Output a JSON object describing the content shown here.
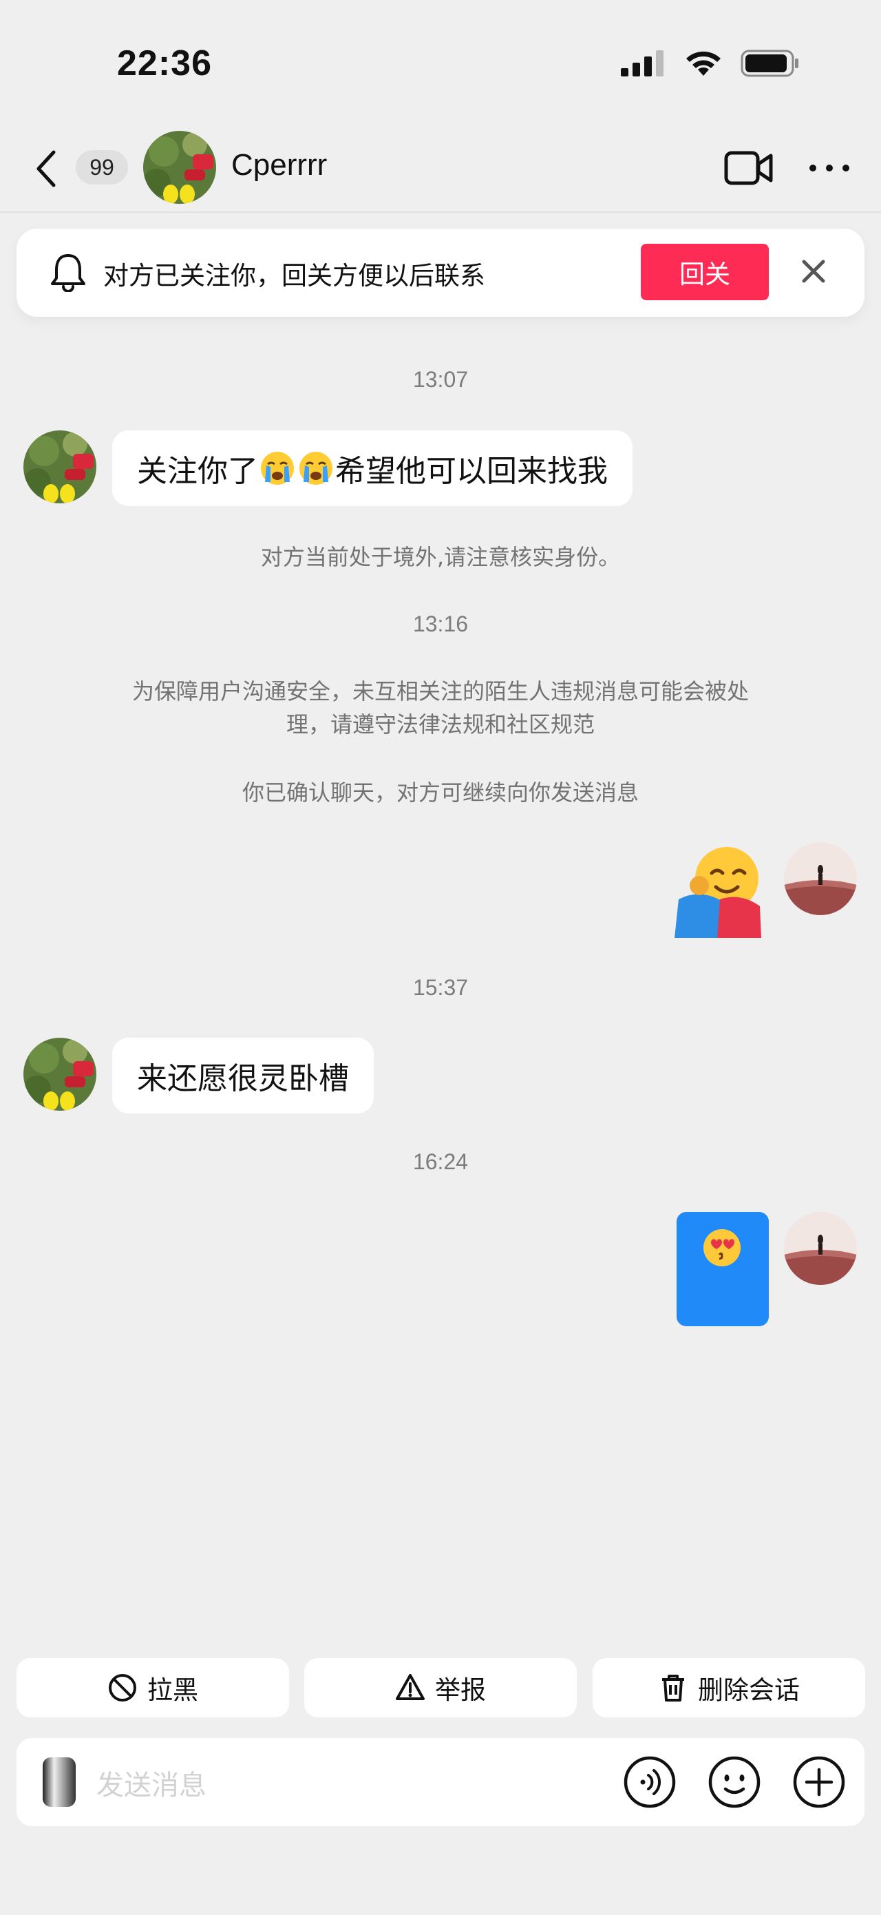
{
  "status_bar": {
    "time": "22:36"
  },
  "header": {
    "unread_count": "99",
    "name": "Cperrrr"
  },
  "banner": {
    "text": "对方已关注你，回关方便以后联系",
    "follow_back": "回关"
  },
  "messages": {
    "t1": "13:07",
    "m1_before": "关注你了",
    "m1_after": "希望他可以回来找我",
    "notice_abroad": "对方当前处于境外,请注意核实身份。",
    "t2": "13:16",
    "notice_safety_line1": "为保障用户沟通安全，未互相关注的陌生人违规消息可能会被处",
    "notice_safety_line2": "理，请遵守法律法规和社区规范",
    "notice_confirm": "你已确认聊天，对方可继续向你发送消息",
    "t3": "15:37",
    "m2": "来还愿很灵卧槽",
    "t4": "16:24"
  },
  "actions": {
    "block": "拉黑",
    "report": "举报",
    "delete": "删除会话"
  },
  "input": {
    "placeholder": "发送消息"
  },
  "colors": {
    "accent": "#fe2c55",
    "card_blue": "#1f8af8",
    "background": "#efefef"
  },
  "icons": [
    "back-arrow-icon",
    "video-call-icon",
    "more-icon",
    "bell-icon",
    "close-icon",
    "block-icon",
    "warning-icon",
    "trash-icon",
    "mic-icon",
    "voice-icon",
    "emoji-icon",
    "plus-icon"
  ]
}
